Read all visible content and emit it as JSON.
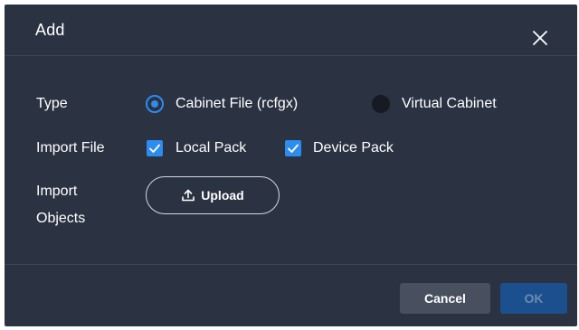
{
  "dialog": {
    "title": "Add",
    "close_icon": "close-icon"
  },
  "form": {
    "type": {
      "label": "Type",
      "options": [
        {
          "label": "Cabinet File (rcfgx)",
          "selected": true
        },
        {
          "label": "Virtual Cabinet",
          "selected": false
        }
      ]
    },
    "import_file": {
      "label": "Import File",
      "options": [
        {
          "label": "Local Pack",
          "checked": true
        },
        {
          "label": "Device Pack",
          "checked": true
        }
      ]
    },
    "import_objects": {
      "label_line1": "Import",
      "label_line2": "Objects",
      "upload_label": "Upload",
      "upload_icon": "upload-icon"
    }
  },
  "footer": {
    "cancel_label": "Cancel",
    "ok_label": "OK",
    "ok_enabled": false
  },
  "colors": {
    "background": "#2b3242",
    "accent": "#2d8cf0",
    "cancel_bg": "#48505f",
    "ok_disabled_bg": "#1b4f8e"
  }
}
